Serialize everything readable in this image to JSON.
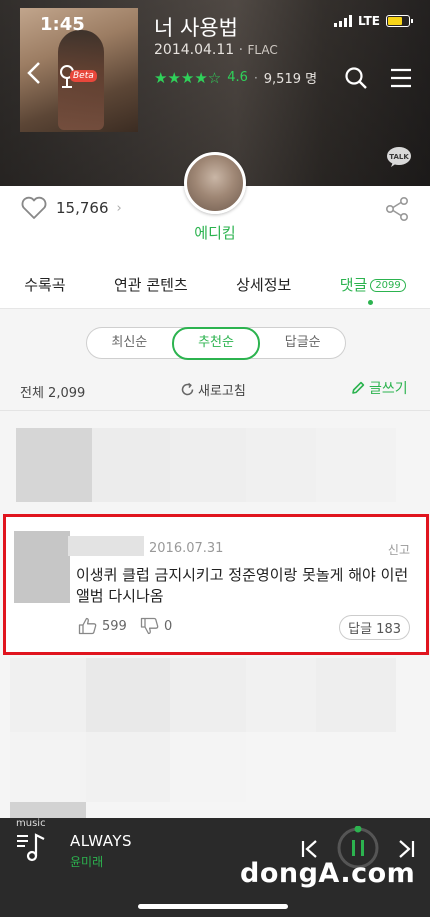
{
  "status": {
    "time": "1:45",
    "network": "LTE"
  },
  "header": {
    "song_title": "너 사용법",
    "date": "2014.04.11",
    "format": "FLAC",
    "stars": "★★★★☆",
    "rating": "4.6",
    "rating_count": "9,519 명",
    "beta_label": "Beta",
    "talk_label": "TALK"
  },
  "artist": {
    "name": "에디킴"
  },
  "likes": {
    "count": "15,766",
    "arrow": "›"
  },
  "tabs": [
    {
      "label": "수록곡"
    },
    {
      "label": "연관 콘텐츠"
    },
    {
      "label": "상세정보"
    },
    {
      "label": "댓글",
      "badge": "2099"
    }
  ],
  "sort": {
    "options": [
      "최신순",
      "추천순",
      "답글순"
    ],
    "selected": "추천순"
  },
  "comments_bar": {
    "total": "전체 2,099",
    "refresh": "새로고침",
    "write": "글쓰기"
  },
  "highlight_comment": {
    "date": "2016.07.31",
    "report": "신고",
    "text": "이생퀴 클럽 금지시키고 정준영이랑 못놀게 해야 이런앨범 다시나옴",
    "likes": "599",
    "dislikes": "0",
    "reply": "답글 183"
  },
  "player": {
    "tag": "music",
    "title": "ALWAYS",
    "artist": "윤미래"
  },
  "watermark": "dongA.com",
  "colors": {
    "accent": "#2cb34f",
    "highlight_border": "#e0141e",
    "star": "#2fd15a",
    "battery": "#f7d418"
  }
}
